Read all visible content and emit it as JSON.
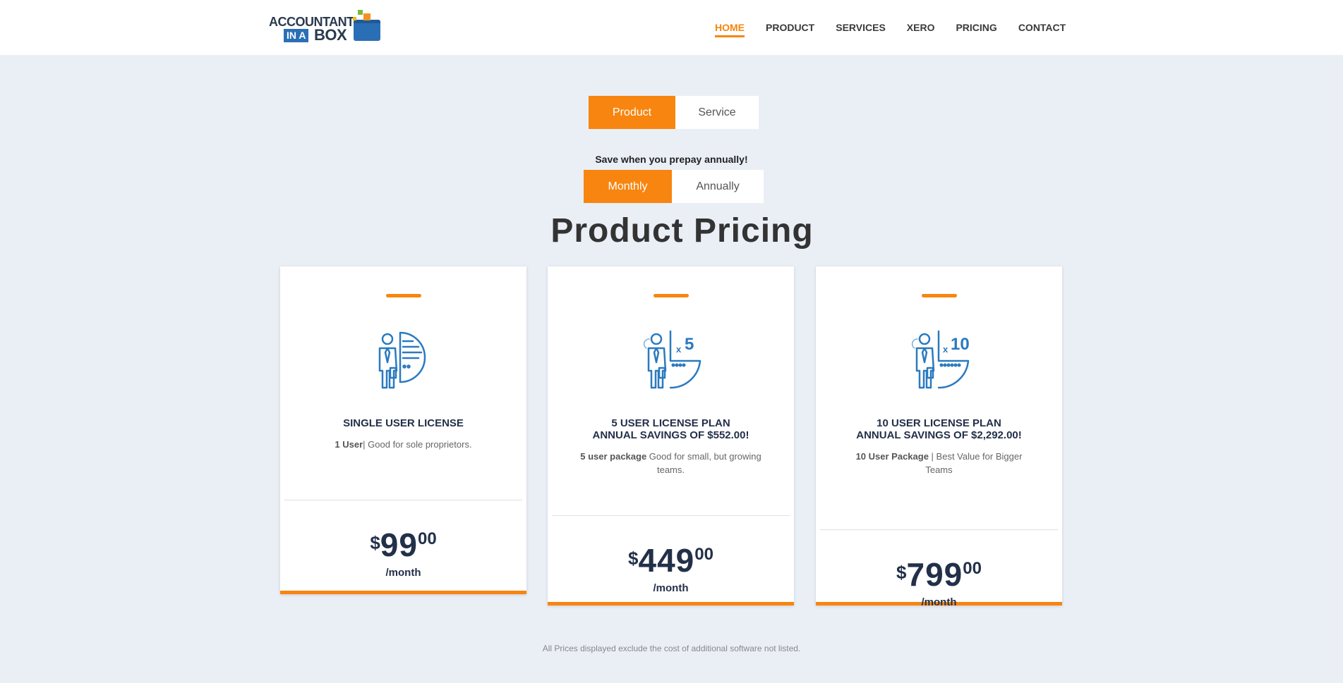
{
  "logo": {
    "line1": "ACCOUNTANT",
    "line2": "IN A",
    "line3": "BOX"
  },
  "nav": [
    "HOME",
    "PRODUCT",
    "SERVICES",
    "XERO",
    "PRICING",
    "CONTACT"
  ],
  "type_toggle": {
    "product": "Product",
    "service": "Service"
  },
  "save_note": "Save when you prepay annually!",
  "period_toggle": {
    "monthly": "Monthly",
    "annually": "Annually"
  },
  "title": "Product Pricing",
  "plans": [
    {
      "name": "SINGLE USER LICENSE",
      "savings": "",
      "desc_bold": "1 User",
      "desc_rest": "| Good for sole proprietors.",
      "currency": "$",
      "amount": "99",
      "cents": "00",
      "period": "/month",
      "icon_label": ""
    },
    {
      "name": "5 USER LICENSE PLAN",
      "savings": "ANNUAL SAVINGS OF $552.00!",
      "desc_bold": "5 user package",
      "desc_rest": " Good for small, but growing teams.",
      "currency": "$",
      "amount": "449",
      "cents": "00",
      "period": "/month",
      "icon_label": "5"
    },
    {
      "name": "10 USER LICENSE PLAN",
      "savings": "ANNUAL SAVINGS OF $2,292.00!",
      "desc_bold": "10 User Package",
      "desc_rest": " | Best Value for Bigger Teams",
      "currency": "$",
      "amount": "799",
      "cents": "00",
      "period": "/month",
      "icon_label": "10"
    }
  ],
  "footnote": "All Prices displayed exclude the cost of additional software not listed.",
  "colors": {
    "accent": "#f7850f",
    "navy": "#223049",
    "icon_blue": "#2a7ac0"
  }
}
